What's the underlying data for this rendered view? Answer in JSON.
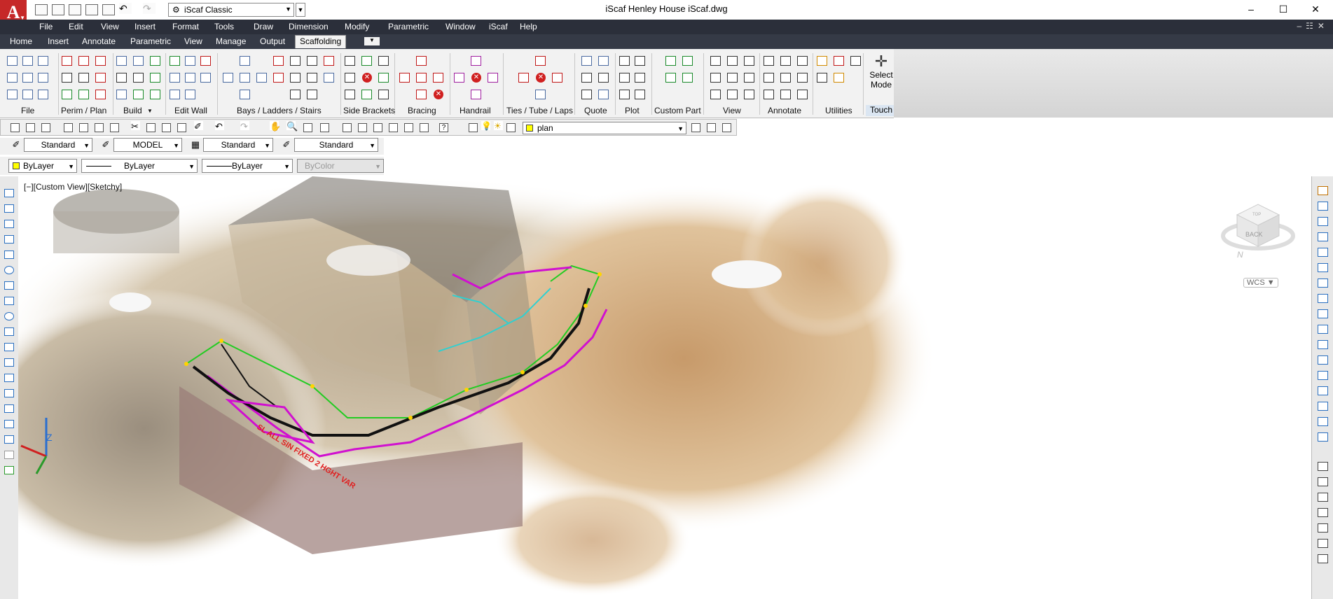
{
  "app": {
    "title": "iScaf      Henley House iScaf.dwg",
    "app_letter": "A",
    "workspace": "iScaf Classic"
  },
  "menu": [
    "File",
    "Edit",
    "View",
    "Insert",
    "Format",
    "Tools",
    "Draw",
    "Dimension",
    "Modify",
    "Parametric",
    "Window",
    "iScaf",
    "Help"
  ],
  "ribbon_tabs": [
    "Home",
    "Insert",
    "Annotate",
    "Parametric",
    "View",
    "Manage",
    "Output",
    "Scaffolding"
  ],
  "active_tab": "Scaffolding",
  "ribbon_groups": [
    "File",
    "Perim / Plan",
    "Build",
    "Edit Wall",
    "Bays / Ladders / Stairs",
    "Side Brackets",
    "Bracing",
    "Handrail",
    "Ties / Tube / Laps",
    "Quote",
    "Plot",
    "Custom Part",
    "View",
    "Annotate",
    "Utilities"
  ],
  "select_mode": {
    "line1": "Select",
    "line2": "Mode",
    "touch": "Touch"
  },
  "toolbar": {
    "layer": "plan",
    "text_style": "Standard",
    "model": "MODEL",
    "dim_style": "Standard",
    "table_style": "Standard",
    "color": "ByLayer",
    "linetype": "ByLayer",
    "lineweight": "ByLayer",
    "plotstyle": "ByColor"
  },
  "viewport": {
    "label": "[−][Custom View][Sketchy]",
    "scaffold_text": "SL ALL SIN FIXED 2 HGHT VAR",
    "viewcube": {
      "face": "BACK",
      "top": "TOP",
      "north": "N",
      "wcs": "WCS"
    },
    "ucs": {
      "axis": "Z"
    }
  }
}
